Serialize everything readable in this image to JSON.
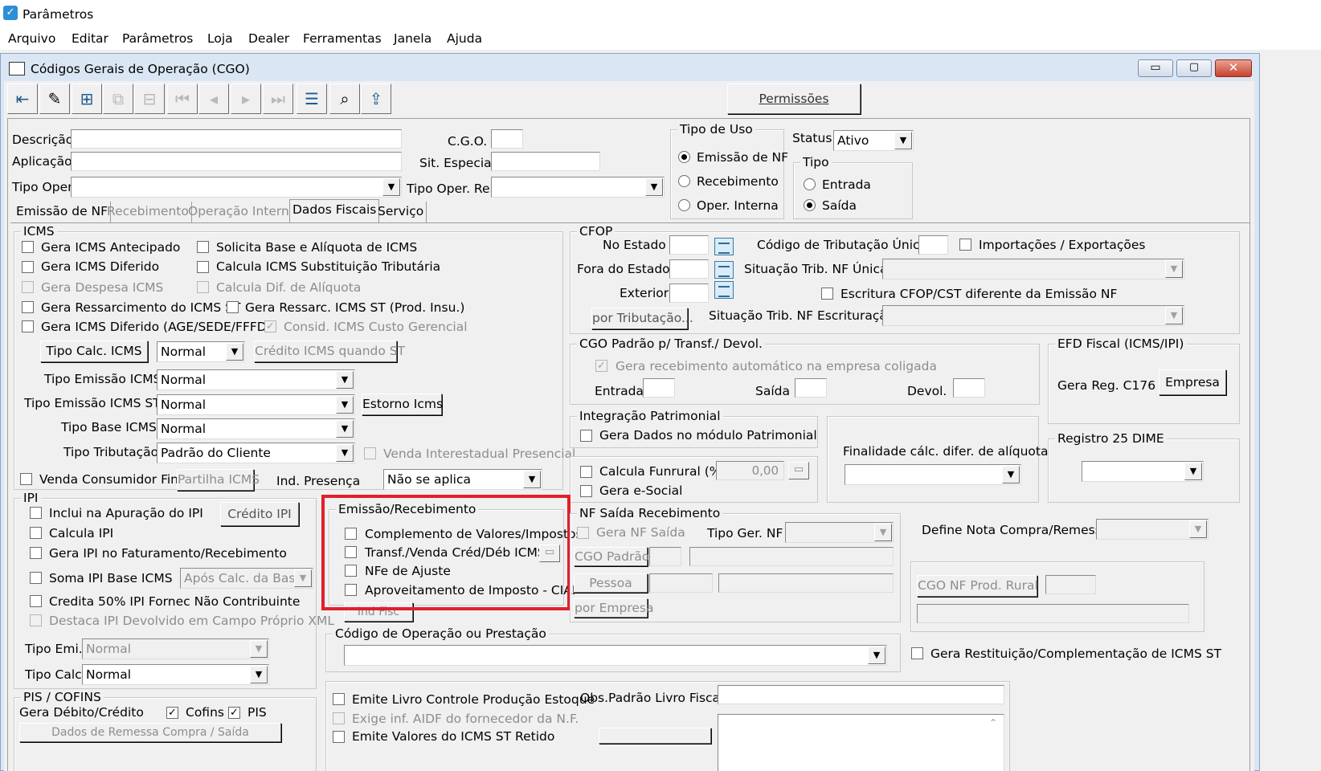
{
  "app_title": "Parâmetros",
  "menu": [
    "Arquivo",
    "Editar",
    "Parâmetros",
    "Loja",
    "Dealer",
    "Ferramentas",
    "Janela",
    "Ajuda"
  ],
  "window_title": "Códigos Gerais de Operação (CGO)",
  "permissoes": "Permissões",
  "header": {
    "descricao": "Descrição",
    "aplicacao": "Aplicação",
    "tipo_oper": "Tipo Oper.",
    "cgo": "C.G.O.",
    "sit_especial": "Sit. Especial",
    "tipo_oper_rel": "Tipo Oper. Rel.",
    "status_label": "Status",
    "status_value": "Ativo"
  },
  "tipo_uso": {
    "title": "Tipo de Uso",
    "emissao": "Emissão de NF",
    "recebimento": "Recebimento",
    "oper_interna": "Oper. Interna"
  },
  "tipo": {
    "title": "Tipo",
    "entrada": "Entrada",
    "saida": "Saída"
  },
  "tabs": [
    "Emissão de NF",
    "Recebimento",
    "Operação Interna",
    "Dados Fiscais",
    "Serviço"
  ],
  "icms": {
    "title": "ICMS",
    "antecipado": "Gera ICMS Antecipado",
    "solicita_base": "Solicita Base e Alíquota de ICMS",
    "diferido": "Gera ICMS Diferido",
    "calcula_st": "Calcula ICMS Substituição Tributária",
    "despesa": "Gera Despesa ICMS",
    "calc_dif": "Calcula Dif. de Alíquota",
    "ressarcimento": "Gera Ressarcimento do ICMS ST",
    "ressarc_prod": "Gera Ressarc. ICMS ST (Prod. Insu.)",
    "diferido_age": "Gera ICMS Diferido (AGE/SEDE/FFFD)",
    "consid_custo": "Consid. ICMS Custo Gerencial",
    "tipo_calc_btn": "Tipo Calc. ICMS",
    "tipo_calc_value": "Normal",
    "credito_st_btn": "Crédito ICMS quando ST",
    "tipo_emissao": "Tipo Emissão ICMS",
    "tipo_emissao_value": "Normal",
    "tipo_emissao_st": "Tipo Emissão ICMS ST",
    "tipo_emissao_st_value": "Normal",
    "estorno_btn": "Estorno Icms",
    "tipo_base": "Tipo Base ICMS",
    "tipo_base_value": "Normal",
    "tipo_tributacao": "Tipo Tributação",
    "tipo_tributacao_value": "Padrão do Cliente",
    "venda_interestadual": "Venda Interestadual Presencial",
    "venda_consumidor": "Venda Consumidor Final",
    "partilha_btn": "Partilha ICMS",
    "ind_presenca": "Ind. Presença",
    "ind_presenca_value": "Não se aplica"
  },
  "ipi": {
    "title": "IPI",
    "inclui": "Inclui na Apuração do IPI",
    "credito_btn": "Crédito IPI",
    "calcula": "Calcula IPI",
    "gera_fat": "Gera IPI no Faturamento/Recebimento",
    "soma_base": "Soma IPI Base ICMS",
    "apos_calc": "Após Calc. da Base",
    "credita_50": "Credita 50% IPI Fornec Não Contribuinte",
    "destaca": "Destaca IPI Devolvido em Campo Próprio XML",
    "tipo_emi": "Tipo Emi.",
    "tipo_emi_value": "Normal",
    "tipo_calc": "Tipo Calc.",
    "tipo_calc_value": "Normal"
  },
  "pis": {
    "title": "PIS / COFINS",
    "gera": "Gera Débito/Crédito",
    "cofins": "Cofins",
    "pis": "PIS",
    "remessa_btn": "Dados de Remessa Compra / Saída"
  },
  "cfop": {
    "title": "CFOP",
    "no_estado": "No Estado",
    "fora_estado": "Fora do Estado",
    "exterior": "Exterior",
    "codigo_trib": "Código de Tributação Único",
    "importacoes": "Importações / Exportações",
    "sit_trib_nf": "Situação Trib. NF Única",
    "escritura": "Escritura CFOP/CST diferente da Emissão NF",
    "por_tributacao": "por Tributação...",
    "sit_trib_escr": "Situação Trib. NF Escrituração"
  },
  "cgo_padrao": {
    "title": "CGO Padrão p/ Transf./ Devol.",
    "gera_receb": "Gera recebimento automático na empresa coligada",
    "entrada": "Entrada",
    "saida": "Saída",
    "devol": "Devol."
  },
  "efd": {
    "title": "EFD Fiscal (ICMS/IPI)",
    "gera_reg": "Gera Reg. C176",
    "empresa_btn": "Empresa"
  },
  "integracao": {
    "title": "Integração Patrimonial",
    "gera_dados": "Gera Dados no módulo Patrimonial"
  },
  "finalidade": "Finalidade cálc. difer. de alíquota",
  "registro25": "Registro 25 DIME",
  "funrural": {
    "calcula": "Calcula Funrural (%)",
    "valor": "0,00",
    "esocial": "Gera e-Social"
  },
  "emissao_receb": {
    "title": "Emissão/Recebimento",
    "complemento": "Complemento de Valores/Impostos",
    "transf": "Transf./Venda Créd/Déb ICMS",
    "nfe_ajuste": "NFe de Ajuste",
    "aproveitamento": "Aproveitamento de Imposto - CIAP",
    "ind_fisc": "Ind Fisc"
  },
  "nf_saida": {
    "title": "NF Saída Recebimento",
    "gera_nf": "Gera NF Saída",
    "tipo_ger": "Tipo Ger. NF",
    "cgo_padrao": "CGO Padrão",
    "pessoa": "Pessoa",
    "por_empresa": "por Empresa"
  },
  "define_nota": "Define Nota Compra/Remessa",
  "cgo_nf_prod": "CGO NF Prod. Rural",
  "codigo_oper": {
    "title": "Código de Operação ou Prestação"
  },
  "gera_restituicao": "Gera Restituição/Complementação de ICMS ST",
  "livro": {
    "emite": "Emite Livro Controle Produção Estoque",
    "exige": "Exige inf. AIDF do fornecedor da N.F.",
    "emite_valores": "Emite Valores do ICMS ST Retido",
    "obs": "Obs.Padrão Livro Fiscal"
  },
  "colors": {
    "highlight": "#e0202a",
    "title_bar": "#dbe6f4"
  }
}
